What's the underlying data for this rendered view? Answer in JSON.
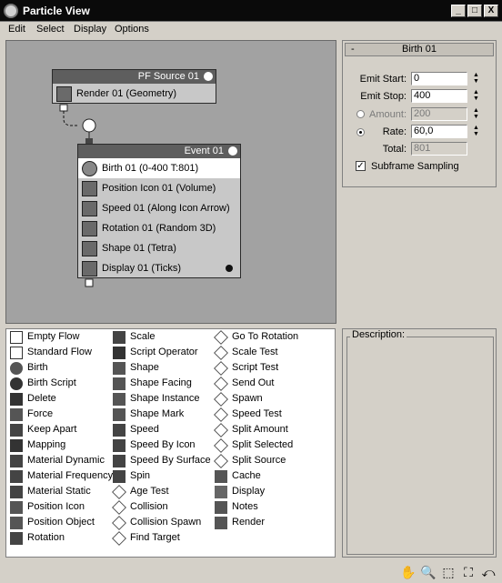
{
  "window": {
    "title": "Particle View",
    "btn_min": "_",
    "btn_max": "□",
    "btn_close": "X"
  },
  "menu": [
    "Edit",
    "Select",
    "Display",
    "Options"
  ],
  "graph": {
    "source_node": {
      "title": "PF Source 01",
      "operators": [
        {
          "label": "Render 01 (Geometry)",
          "icon": "render-icon"
        }
      ]
    },
    "event_node": {
      "title": "Event 01",
      "operators": [
        {
          "label": "Birth 01 (0-400 T:801)",
          "icon": "birth-icon"
        },
        {
          "label": "Position Icon 01 (Volume)",
          "icon": "position-icon"
        },
        {
          "label": "Speed 01 (Along Icon Arrow)",
          "icon": "speed-icon"
        },
        {
          "label": "Rotation 01 (Random 3D)",
          "icon": "rotation-icon"
        },
        {
          "label": "Shape 01 (Tetra)",
          "icon": "shape-icon"
        },
        {
          "label": "Display 01 (Ticks)",
          "icon": "display-icon"
        }
      ]
    }
  },
  "params": {
    "rollout_title": "Birth 01",
    "rollout_toggle": "-",
    "emit_start": {
      "label": "Emit Start:",
      "value": "0"
    },
    "emit_stop": {
      "label": "Emit Stop:",
      "value": "400"
    },
    "amount": {
      "label": "Amount:",
      "value": "200"
    },
    "rate": {
      "label": "Rate:",
      "value": "60,0"
    },
    "total": {
      "label": "Total:",
      "value": "801"
    },
    "subframe": {
      "label": "Subframe Sampling",
      "checked": "✓"
    },
    "spin_up": "▲",
    "spin_down": "▼"
  },
  "depot": {
    "col1": [
      "Empty Flow",
      "Standard Flow",
      "Birth",
      "Birth Script",
      "Delete",
      "Force",
      "Keep Apart",
      "Mapping",
      "Material Dynamic",
      "Material Frequency",
      "Material Static",
      "Position Icon",
      "Position Object",
      "Rotation"
    ],
    "col2": [
      "Scale",
      "Script Operator",
      "Shape",
      "Shape Facing",
      "Shape Instance",
      "Shape Mark",
      "Speed",
      "Speed By Icon",
      "Speed By Surface",
      "Spin",
      "Age Test",
      "Collision",
      "Collision Spawn",
      "Find Target"
    ],
    "col3": [
      "Go To Rotation",
      "Scale Test",
      "Script Test",
      "Send Out",
      "Spawn",
      "Speed Test",
      "Split Amount",
      "Split Selected",
      "Split Source",
      "Cache",
      "Display",
      "Notes",
      "Render"
    ]
  },
  "description": {
    "label": "Description:"
  },
  "bottom_tools": {
    "pan": "✋",
    "zoom": "🔍",
    "zoom_region": "⬚",
    "zoom_extents": "⛶",
    "undo_zoom": "⤺"
  }
}
